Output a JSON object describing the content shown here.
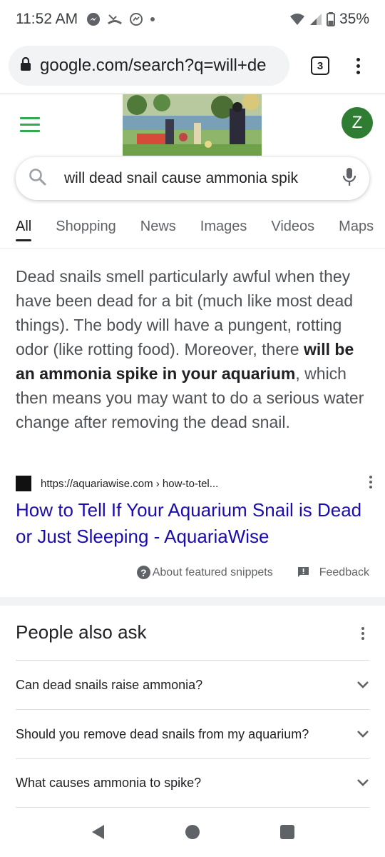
{
  "status_bar": {
    "time": "11:52 AM",
    "battery": "35%"
  },
  "browser": {
    "url": "google.com/search?q=will+de",
    "tab_count": "3"
  },
  "header": {
    "avatar_letter": "Z"
  },
  "search": {
    "query": "will dead snail cause ammonia spik"
  },
  "tabs": [
    "All",
    "Shopping",
    "News",
    "Images",
    "Videos",
    "Maps"
  ],
  "snippet": {
    "text_before": "Dead snails smell particularly awful when they have been dead for a bit (much like most dead things). The body will have a pungent, rotting odor (like rotting food). Moreover, there ",
    "text_bold": "will be an ammonia spike in your aquarium",
    "text_after": ", which then means you may want to do a serious water change after removing the dead snail.",
    "source_url": "https://aquariawise.com › how-to-tel...",
    "title": "How to Tell If Your Aquarium Snail is Dead or Just Sleeping - AquariaWise",
    "about_label": "About featured snippets",
    "feedback_label": "Feedback"
  },
  "people_also_ask": {
    "title": "People also ask",
    "questions": [
      "Can dead snails raise ammonia?",
      "Should you remove dead snails from my aquarium?",
      "What causes ammonia to spike?"
    ]
  },
  "colors": {
    "link": "#1a0dab",
    "accent_green": "#34a853",
    "avatar_bg": "#2e7d32"
  }
}
